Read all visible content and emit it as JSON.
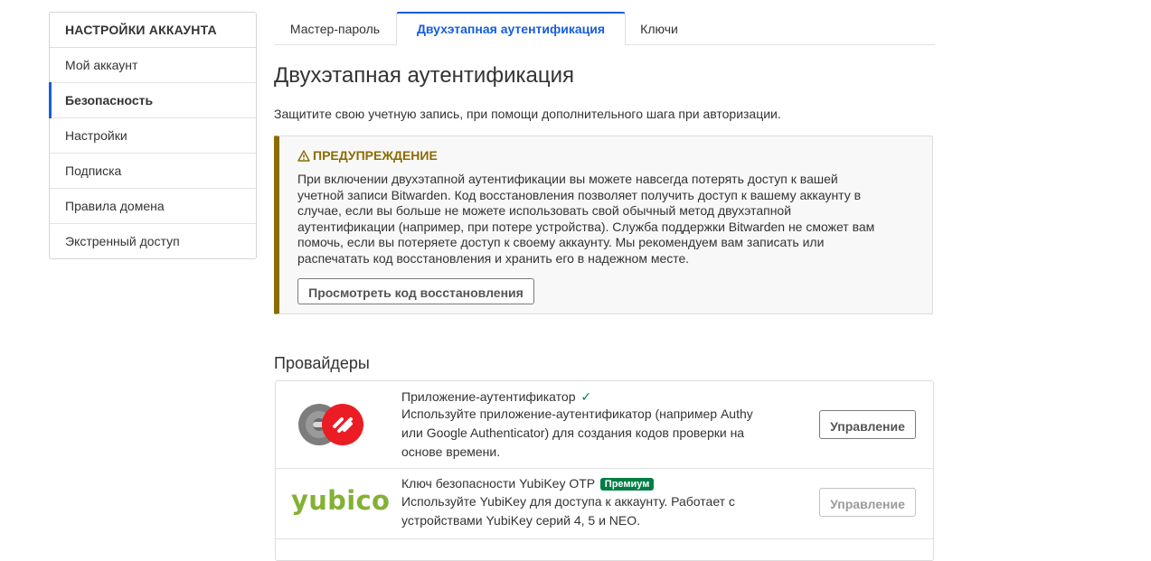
{
  "sidebar": {
    "heading": "НАСТРОЙКИ АККАУНТА",
    "items": [
      {
        "label": "Мой аккаунт"
      },
      {
        "label": "Безопасность"
      },
      {
        "label": "Настройки"
      },
      {
        "label": "Подписка"
      },
      {
        "label": "Правила домена"
      },
      {
        "label": "Экстренный доступ"
      }
    ]
  },
  "tabs": [
    {
      "label": "Мастер-пароль"
    },
    {
      "label": "Двухэтапная аутентификация"
    },
    {
      "label": "Ключи"
    }
  ],
  "main": {
    "title": "Двухэтапная аутентификация",
    "subtitle": "Защитите свою учетную запись, при помощи дополнительного шага при авторизации."
  },
  "warning": {
    "title": "ПРЕДУПРЕЖДЕНИЕ",
    "lines": [
      "При включении двухэтапной аутентификации вы можете навсегда потерять доступ к вашей",
      "учетной записи Bitwarden. Код восстановления позволяет получить доступ к вашему аккаунту в",
      "случае, если вы больше не можете использовать свой обычный метод двухэтапной",
      "аутентификации (например, при потере устройства). Служба поддержки Bitwarden не сможет вам",
      "помочь, если вы потеряете доступ к своему аккаунту. Мы рекомендуем вам записать или",
      "распечатать код восстановления и хранить его в надежном месте."
    ],
    "button_label": "Просмотреть код восстановления"
  },
  "providers": {
    "heading": "Провайдеры",
    "items": [
      {
        "name": "Приложение-аутентификатор",
        "checkmark": "✓",
        "description_lines": [
          "Используйте приложение-аутентификатор (например Authy",
          "или Google Authenticator) для создания кодов проверки на",
          "основе времени."
        ],
        "button_label": "Управление"
      },
      {
        "name": "Ключ безопасности YubiKey OTP",
        "badge": "Премиум",
        "logo_text": "yubico",
        "description_lines": [
          "Используйте YubiKey для доступа к аккаунту. Работает с",
          "устройствами YubiKey серий 4, 5 и NEO."
        ],
        "button_label": "Управление"
      }
    ]
  },
  "colors": {
    "accent": "#175ddc",
    "warning": "#8a6c00",
    "premium": "#017e45",
    "yubico": "#84b135",
    "authy_red": "#ec1c24"
  }
}
